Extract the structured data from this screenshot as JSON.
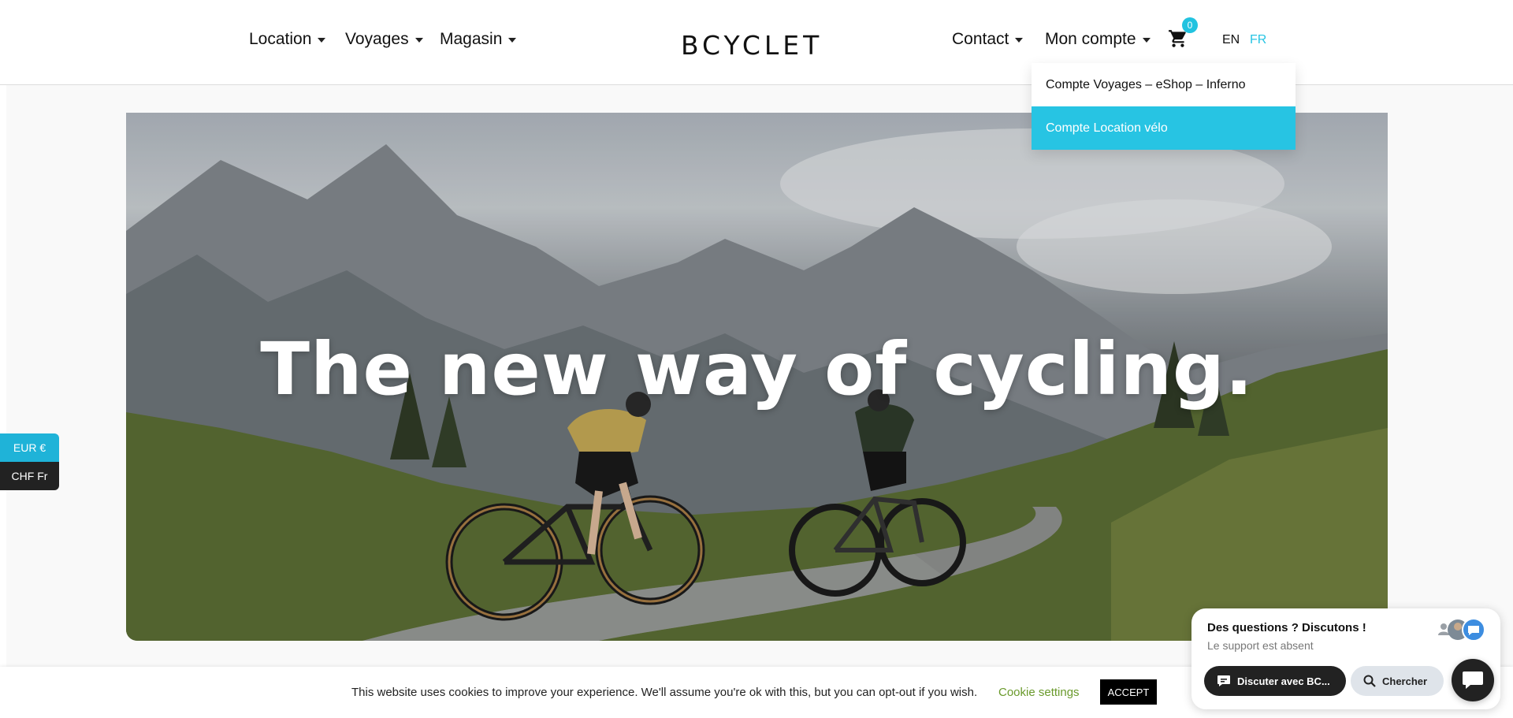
{
  "header": {
    "nav_left": [
      {
        "label": "Location"
      },
      {
        "label": "Voyages"
      },
      {
        "label": "Magasin"
      }
    ],
    "logo": "BCYCLET",
    "nav_right": [
      {
        "label": "Contact"
      },
      {
        "label": "Mon compte"
      }
    ],
    "cart_count": "0",
    "cart_icon": "cart-icon",
    "languages": [
      {
        "label": "EN",
        "active": false
      },
      {
        "label": "FR",
        "active": true
      }
    ]
  },
  "account_dropdown": {
    "items": [
      {
        "label": "Compte Voyages – eShop – Inferno",
        "active": false
      },
      {
        "label": "Compte Location vélo",
        "active": true
      }
    ]
  },
  "hero": {
    "title": "The new way of cycling."
  },
  "currency": {
    "options": [
      {
        "label": "EUR €",
        "active": true
      },
      {
        "label": "CHF Fr",
        "active": false
      }
    ]
  },
  "cookie_bar": {
    "text": "This website uses cookies to improve your experience. We'll assume you're ok with this, but you can opt-out if you wish.",
    "settings_label": "Cookie settings",
    "accept_label": "ACCEPT"
  },
  "chat": {
    "title": "Des questions ? Discutons !",
    "subtitle": "Le support est absent",
    "chat_button": "Discuter avec BC...",
    "search_button": "Chercher"
  },
  "colors": {
    "accent": "#27c4e3",
    "cookie_link": "#6a9a2c",
    "dark": "#222222"
  }
}
